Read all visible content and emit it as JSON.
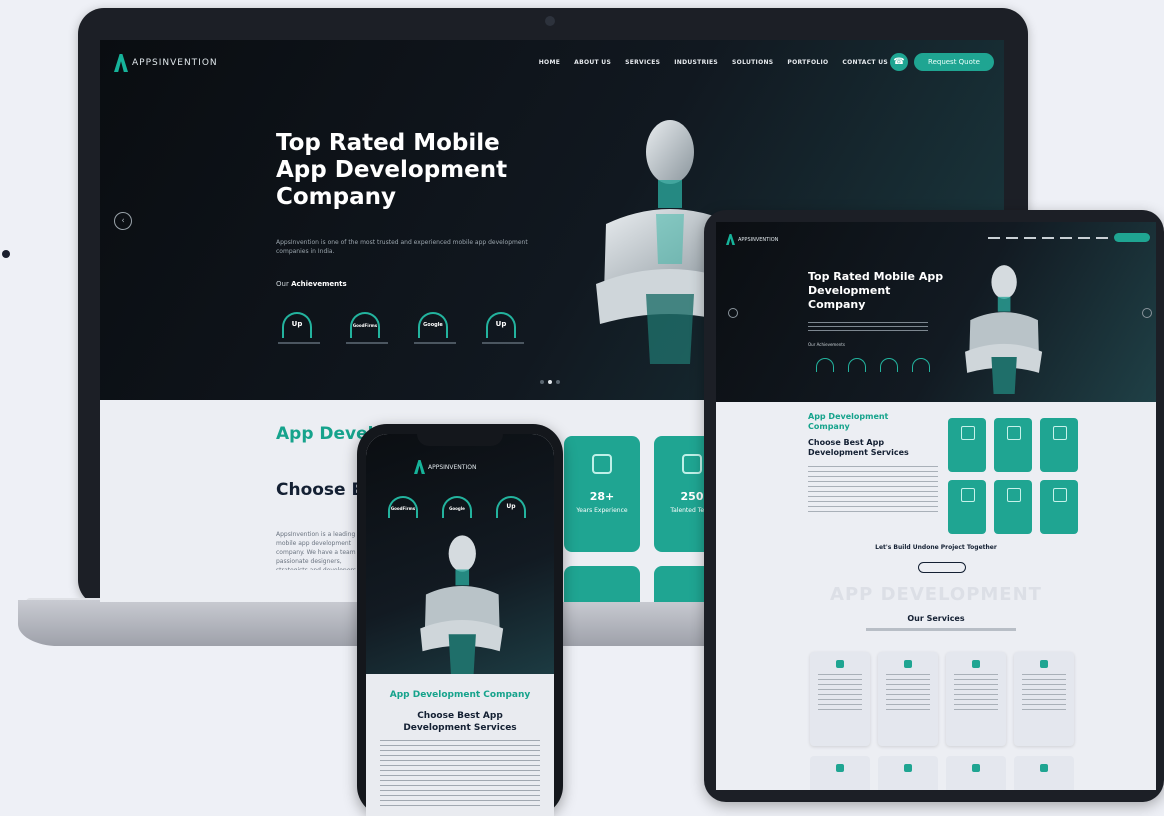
{
  "laptop": {
    "logo_text": "APPSINVENTION",
    "nav": [
      "HOME",
      "ABOUT US",
      "SERVICES",
      "INDUSTRIES",
      "SOLUTIONS",
      "PORTFOLIO",
      "CONTACT US"
    ],
    "quote_label": "Request Quote",
    "hero": {
      "title": "Top Rated Mobile App Development Company",
      "subtitle": "AppsInvention is one of the most trusted and experienced mobile app development companies in India.",
      "achievements_prefix": "Our",
      "achievements_label": "Achievements",
      "badges": [
        "Up",
        "GoodFirms",
        "Google",
        "Up"
      ]
    },
    "lower": {
      "heading": "App Development Company",
      "subheading": "Choose Best App Development Services",
      "paragraph": "AppsInvention is a leading mobile app development company. We have a team of passionate designers, strategists and developers serving different industries. Mobile app.",
      "tiles": [
        {
          "number": "28+",
          "label": "Years Experience"
        },
        {
          "number": "250",
          "label": "Talented Team"
        }
      ]
    }
  },
  "tablet": {
    "hero_title": "Top Rated Mobile App Development Company",
    "achievements": "Our Achievements",
    "heading": "App Development Company",
    "subheading": "Choose Best App Development Services",
    "cta": "Let's Build Undone Project Together",
    "ghost_text": "APP DEVELOPMENT",
    "services_title": "Our Services"
  },
  "phone": {
    "logo_text": "APPSINVENTION",
    "badges": [
      "GoodFirms",
      "Google",
      "Up"
    ],
    "heading": "App Development Company",
    "subheading": "Choose Best App Development Services"
  },
  "colors": {
    "accent": "#1fa592",
    "heading_green": "#16a38c",
    "dark_bg": "#0c0f13",
    "navy_text": "#142033"
  }
}
